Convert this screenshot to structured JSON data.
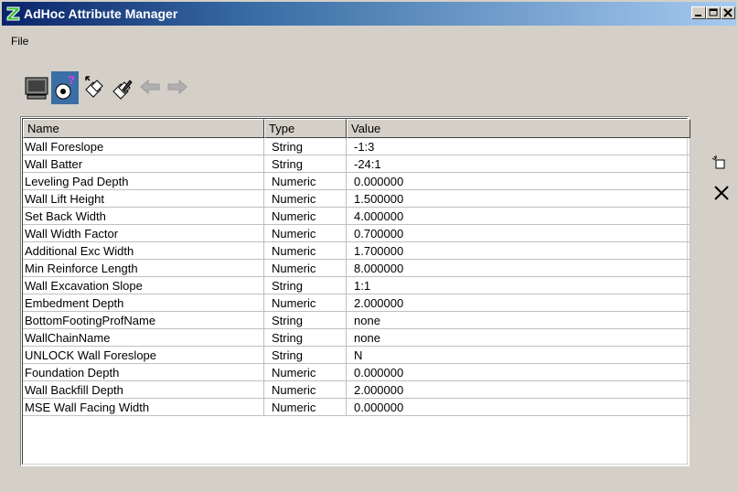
{
  "window": {
    "title": "AdHoc Attribute Manager",
    "colors": {
      "title_start": "#0a246a",
      "title_end": "#a6caf0",
      "face": "#d4d0c8"
    }
  },
  "menu": {
    "items": [
      "File"
    ]
  },
  "toolbar": {
    "tools": [
      "monitor-icon",
      "attribute-query-icon",
      "attribute-add-icon",
      "attribute-edit-icon",
      "arrow-left-icon",
      "arrow-right-icon"
    ]
  },
  "table": {
    "columns": [
      "Name",
      "Type",
      "Value"
    ],
    "rows": [
      [
        "Wall Foreslope",
        "String",
        "-1:3"
      ],
      [
        "Wall Batter",
        "String",
        "-24:1"
      ],
      [
        "Leveling Pad Depth",
        "Numeric",
        "0.000000"
      ],
      [
        "Wall Lift Height",
        "Numeric",
        "1.500000"
      ],
      [
        "Set Back Width",
        "Numeric",
        "4.000000"
      ],
      [
        "Wall Width Factor",
        "Numeric",
        "0.700000"
      ],
      [
        "Additional Exc Width",
        "Numeric",
        "1.700000"
      ],
      [
        "Min Reinforce Length",
        "Numeric",
        "8.000000"
      ],
      [
        "Wall Excavation Slope",
        "String",
        "1:1"
      ],
      [
        "Embedment Depth",
        "Numeric",
        "2.000000"
      ],
      [
        "BottomFootingProfName",
        "String",
        "none"
      ],
      [
        "WallChainName",
        "String",
        "none"
      ],
      [
        "UNLOCK Wall Foreslope",
        "String",
        "N"
      ],
      [
        "Foundation Depth",
        "Numeric",
        "0.000000"
      ],
      [
        "Wall Backfill Depth",
        "Numeric",
        "2.000000"
      ],
      [
        "MSE Wall Facing Width",
        "Numeric",
        "0.000000"
      ]
    ]
  },
  "side_buttons": [
    "new-item-icon",
    "delete-icon"
  ]
}
